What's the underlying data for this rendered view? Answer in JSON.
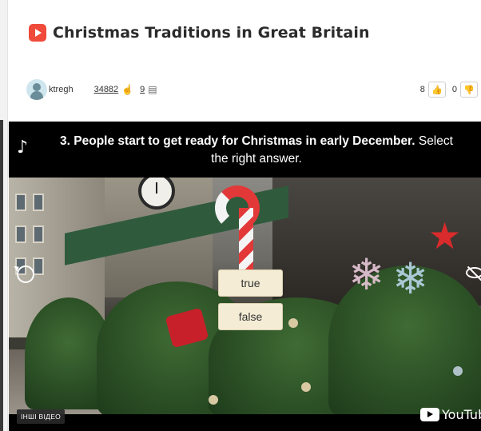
{
  "page": {
    "title": "Christmas Traditions in Great Britain",
    "title_icon": "youtube-badge-icon"
  },
  "meta": {
    "username": "ktregh",
    "views": "34882",
    "comments": "9",
    "likes": "8",
    "dislikes": "0"
  },
  "video": {
    "question_number_bold": "3. People start to get ready for Christmas in early December.",
    "question_instruction": " Select the right answer.",
    "answers": [
      "true",
      "false"
    ],
    "more_videos_label": "ІНШІ ВІДЕО",
    "youtube_logo_text": "YouTube"
  },
  "colors": {
    "accent_red": "#f04a3a",
    "answer_bg": "#f4ecd5"
  }
}
